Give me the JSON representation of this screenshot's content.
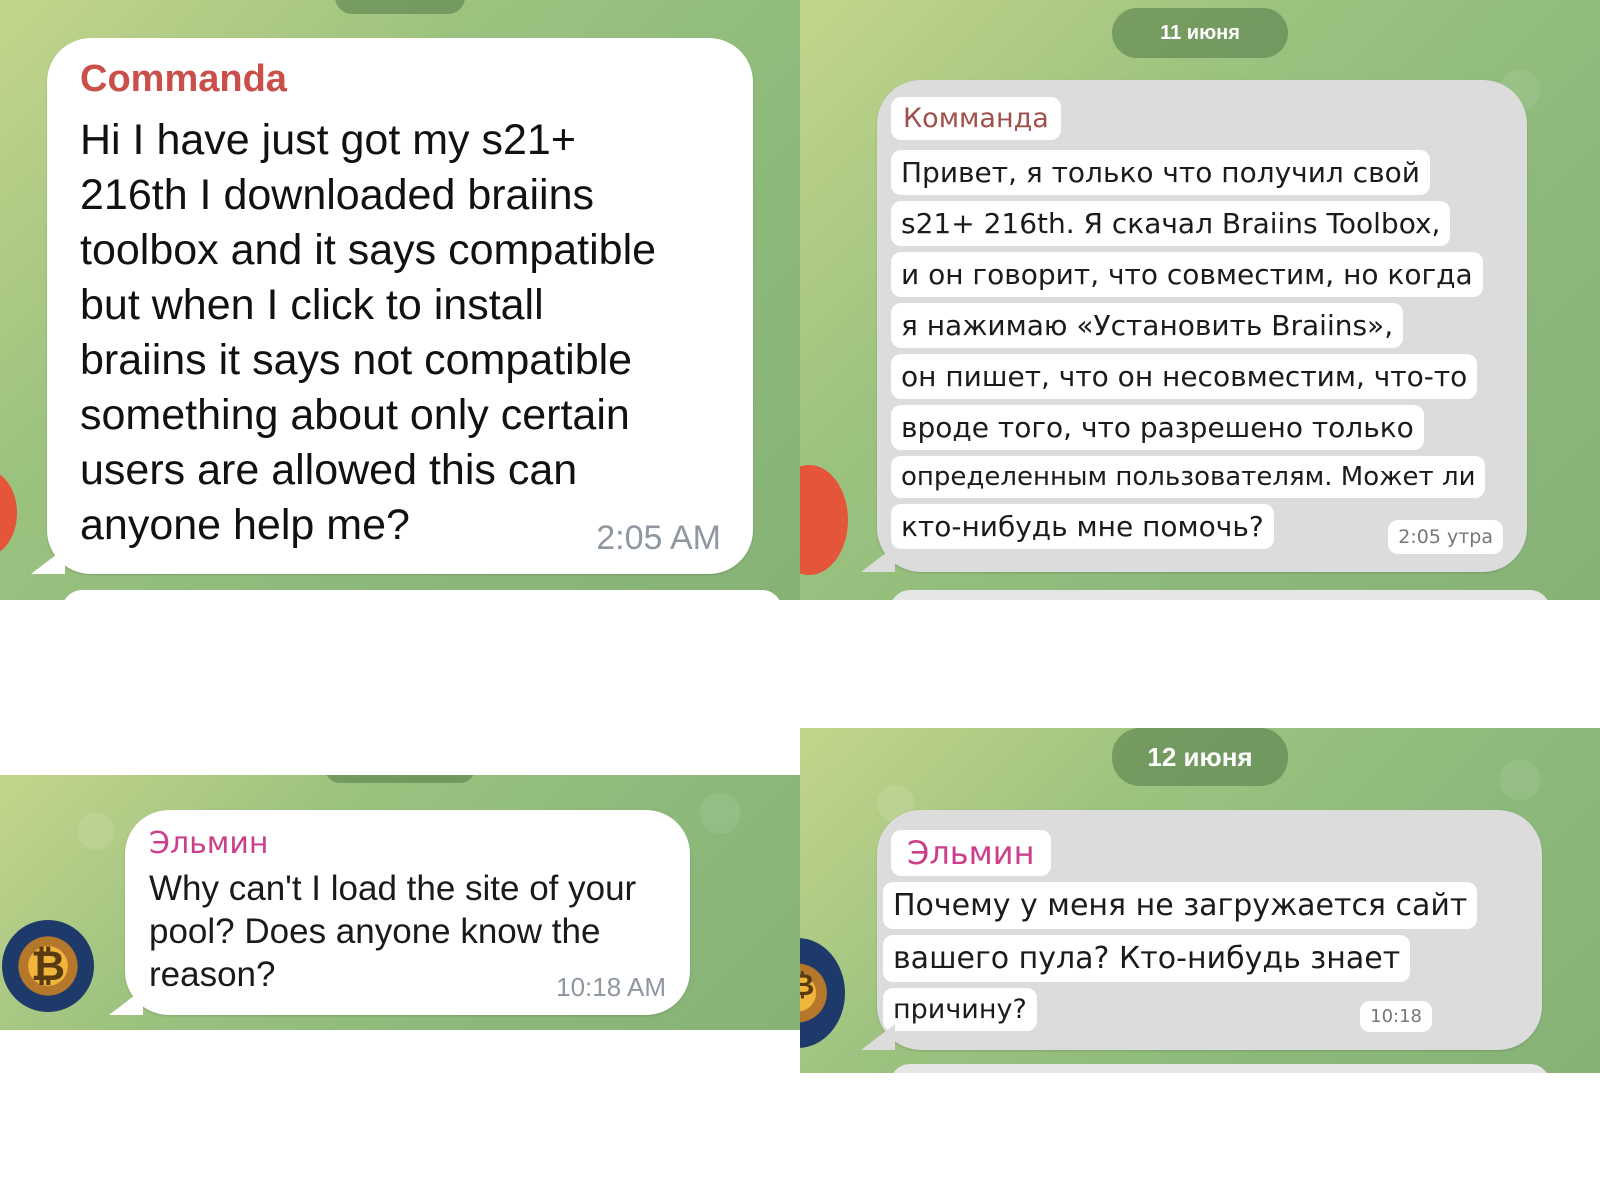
{
  "top_left": {
    "sender": "Commanda",
    "message_lines": [
      "Hi I have just got my s21+",
      "216th I downloaded braiins",
      "toolbox and it says compatible",
      "but when I click to install",
      "braiins it says not compatible",
      "something about only certain",
      "users are allowed this can",
      "anyone help me?"
    ],
    "time": "2:05 AM"
  },
  "top_right": {
    "date": "11 июня",
    "sender": "Комманда",
    "message_lines": [
      "Привет, я только что получил свой",
      "s21+ 216th. Я скачал Braiins Toolbox,",
      "и он говорит, что совместим, но когда",
      "я нажимаю «Установить Braiins»,",
      "он пишет, что он несовместим, что-то",
      "вроде того, что разрешено только",
      "определенным пользователям. Может ли",
      "кто-нибудь мне помочь?"
    ],
    "time": "2:05 утра"
  },
  "bottom_left": {
    "sender": "Эльмин",
    "message_lines": [
      "Why can't I load the site of your",
      "pool? Does anyone know the",
      "reason?"
    ],
    "time": "10:18 AM"
  },
  "bottom_right": {
    "date": "12 июня",
    "sender": "Эльмин",
    "message_lines": [
      "Почему у меня не загружается сайт",
      "вашего пула? Кто-нибудь знает",
      "причину?"
    ],
    "time": "10:18"
  },
  "colors": {
    "sender_commanda": "#c9504a",
    "sender_ru_commanda": "#a0504a",
    "sender_elmin": "#cc3f8a",
    "accent_avatar_orange": "#e4553a"
  },
  "icons": {
    "avatar_bitcoin": "bitcoin-icon"
  }
}
